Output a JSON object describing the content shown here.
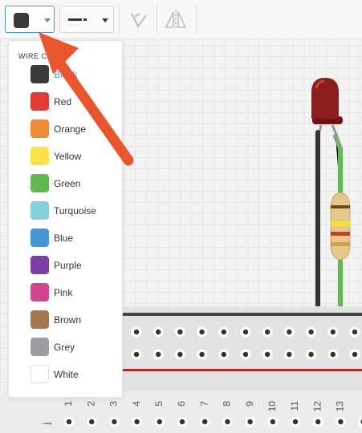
{
  "toolbar": {
    "wire_color_button": {
      "selected_color": "#3a3a3a"
    },
    "wire_style_button": {
      "icon": "line-style-icon"
    },
    "rotate_icon": "rotate-icon",
    "flip_icon": "flip-icon"
  },
  "menu": {
    "title": "WIRE COLOR",
    "items": [
      {
        "label": "Black",
        "color": "#3a3b3c",
        "selected": true
      },
      {
        "label": "Red",
        "color": "#e03a33"
      },
      {
        "label": "Orange",
        "color": "#ef8b36"
      },
      {
        "label": "Yellow",
        "color": "#fbe04a"
      },
      {
        "label": "Green",
        "color": "#62b954"
      },
      {
        "label": "Turquoise",
        "color": "#86cfdd"
      },
      {
        "label": "Blue",
        "color": "#4596d6"
      },
      {
        "label": "Purple",
        "color": "#7a3fa0"
      },
      {
        "label": "Pink",
        "color": "#d3468f"
      },
      {
        "label": "Brown",
        "color": "#a5774f"
      },
      {
        "label": "Grey",
        "color": "#9b9ea2"
      },
      {
        "label": "White",
        "color": "#ffffff"
      }
    ]
  },
  "breadboard": {
    "column_numbers": [
      "1",
      "2",
      "3",
      "4",
      "5",
      "6",
      "7",
      "8",
      "9",
      "10",
      "11",
      "12",
      "13"
    ],
    "row_letter": "j"
  },
  "annotation": {
    "arrow_color": "#e8552e"
  }
}
